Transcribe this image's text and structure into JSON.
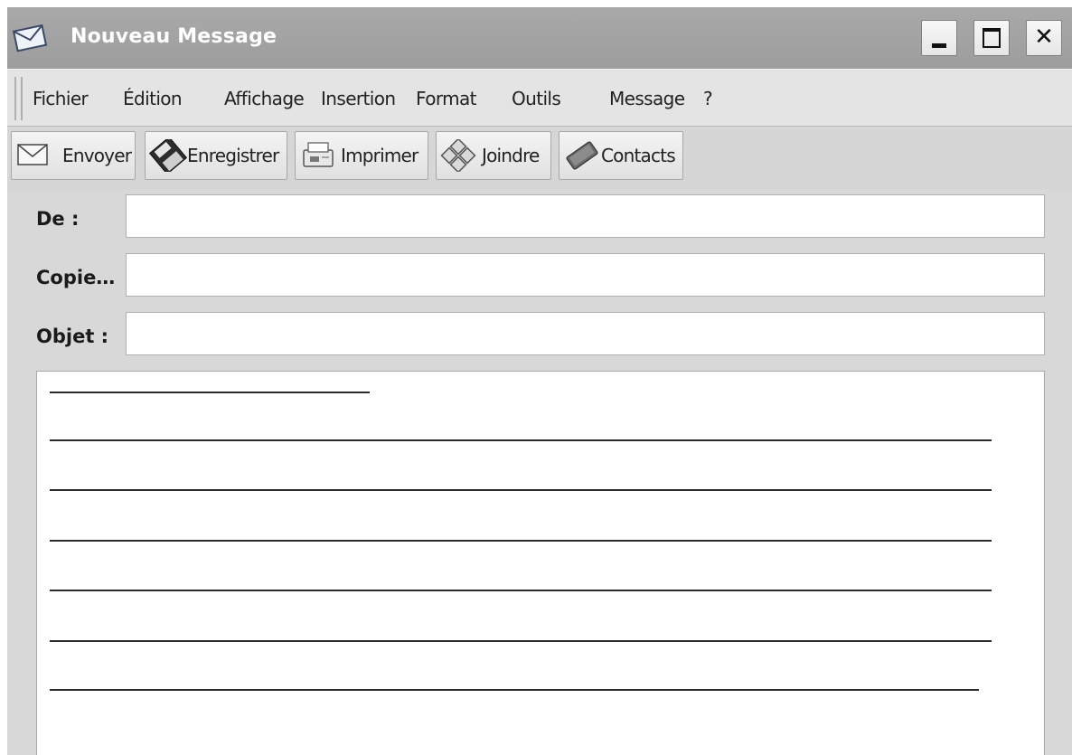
{
  "window": {
    "title": "Nouveau Message"
  },
  "menu": {
    "items": [
      "Fichier",
      "Édition",
      "Affichage",
      "Insertion",
      "Format",
      "Outils",
      "Message",
      "?"
    ]
  },
  "toolbar": {
    "buttons": [
      {
        "label": "Envoyer",
        "icon": "envelope-icon"
      },
      {
        "label": "Enregistrer",
        "icon": "diskette-icon"
      },
      {
        "label": "Imprimer",
        "icon": "printer-icon"
      },
      {
        "label": "Joindre",
        "icon": "paperclip-icon"
      },
      {
        "label": "Contacts",
        "icon": "address-book-icon"
      }
    ]
  },
  "fields": {
    "from_label": "De :",
    "from_value": "",
    "cc_label": "Copie…",
    "cc_value": "",
    "subject_label": "Objet :",
    "subject_value": ""
  },
  "message_body": {
    "blank_lines": 6
  },
  "colors": {
    "titlebar": "#a3a3a3",
    "window_bg": "#d8d8d8",
    "field_bg": "#ffffff"
  }
}
